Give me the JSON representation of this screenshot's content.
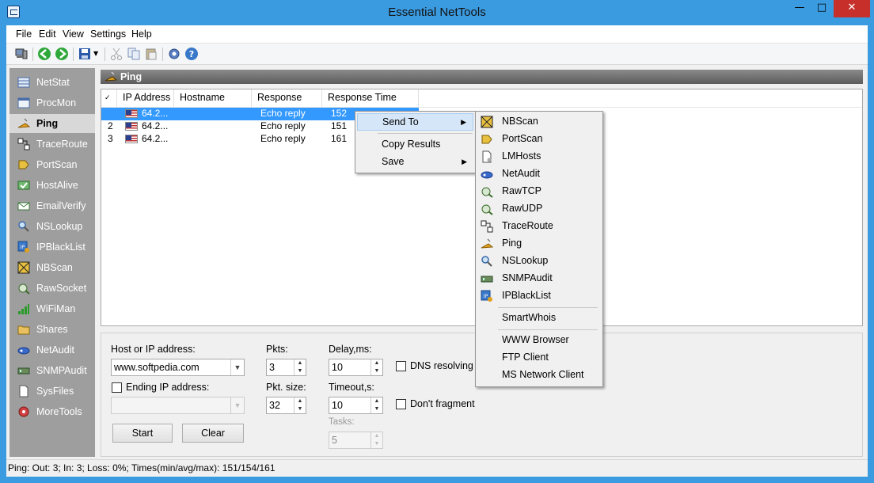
{
  "window": {
    "title": "Essential NetTools"
  },
  "menu": [
    "File",
    "Edit",
    "View",
    "Settings",
    "Help"
  ],
  "sidebar": {
    "items": [
      {
        "label": "NetStat",
        "icon": "netstat-icon"
      },
      {
        "label": "ProcMon",
        "icon": "procmon-icon"
      },
      {
        "label": "Ping",
        "icon": "ping-icon",
        "active": true
      },
      {
        "label": "TraceRoute",
        "icon": "traceroute-icon"
      },
      {
        "label": "PortScan",
        "icon": "portscan-icon"
      },
      {
        "label": "HostAlive",
        "icon": "hostalive-icon"
      },
      {
        "label": "EmailVerify",
        "icon": "emailverify-icon"
      },
      {
        "label": "NSLookup",
        "icon": "nslookup-icon"
      },
      {
        "label": "IPBlackList",
        "icon": "ipblacklist-icon"
      },
      {
        "label": "NBScan",
        "icon": "nbscan-icon"
      },
      {
        "label": "RawSocket",
        "icon": "rawsocket-icon"
      },
      {
        "label": "WiFiMan",
        "icon": "wifiman-icon"
      },
      {
        "label": "Shares",
        "icon": "shares-icon"
      },
      {
        "label": "NetAudit",
        "icon": "netaudit-icon"
      },
      {
        "label": "SNMPAudit",
        "icon": "snmpaudit-icon"
      },
      {
        "label": "SysFiles",
        "icon": "sysfiles-icon"
      },
      {
        "label": "MoreTools",
        "icon": "moretools-icon"
      }
    ]
  },
  "panel": {
    "title": "Ping"
  },
  "list": {
    "columns": [
      "IP Address",
      "Hostname",
      "Response Msg",
      "Response Time"
    ],
    "rows": [
      {
        "num": "",
        "ip": "64.2...",
        "host": "",
        "msg": "Echo reply",
        "time": "152"
      },
      {
        "num": "2",
        "ip": "64.2...",
        "host": "",
        "msg": "Echo reply",
        "time": "151"
      },
      {
        "num": "3",
        "ip": "64.2...",
        "host": "",
        "msg": "Echo reply",
        "time": "161"
      }
    ]
  },
  "form": {
    "host_label": "Host or IP address:",
    "host_value": "www.softpedia.com",
    "ending_label": "Ending IP address:",
    "ending_value": "",
    "pkts_label": "Pkts:",
    "pkts_value": "3",
    "pktsize_label": "Pkt. size:",
    "pktsize_value": "32",
    "delay_label": "Delay,ms:",
    "delay_value": "10",
    "timeout_label": "Timeout,s:",
    "timeout_value": "10",
    "tasks_label": "Tasks:",
    "tasks_value": "5",
    "dns_label": "DNS resolving",
    "frag_label": "Don't fragment",
    "start_label": "Start",
    "clear_label": "Clear"
  },
  "status": {
    "text": "Ping: Out: 3; In: 3; Loss: 0%; Times(min/avg/max): 151/154/161"
  },
  "context_menu": {
    "items": [
      "Send To",
      "Copy Results",
      "Save"
    ]
  },
  "submenu": {
    "items": [
      "NBScan",
      "PortScan",
      "LMHosts",
      "NetAudit",
      "RawTCP",
      "RawUDP",
      "TraceRoute",
      "Ping",
      "NSLookup",
      "SNMPAudit",
      "IPBlackList"
    ],
    "extra": [
      "SmartWhois"
    ],
    "external": [
      "WWW Browser",
      "FTP Client",
      "MS Network Client"
    ]
  }
}
